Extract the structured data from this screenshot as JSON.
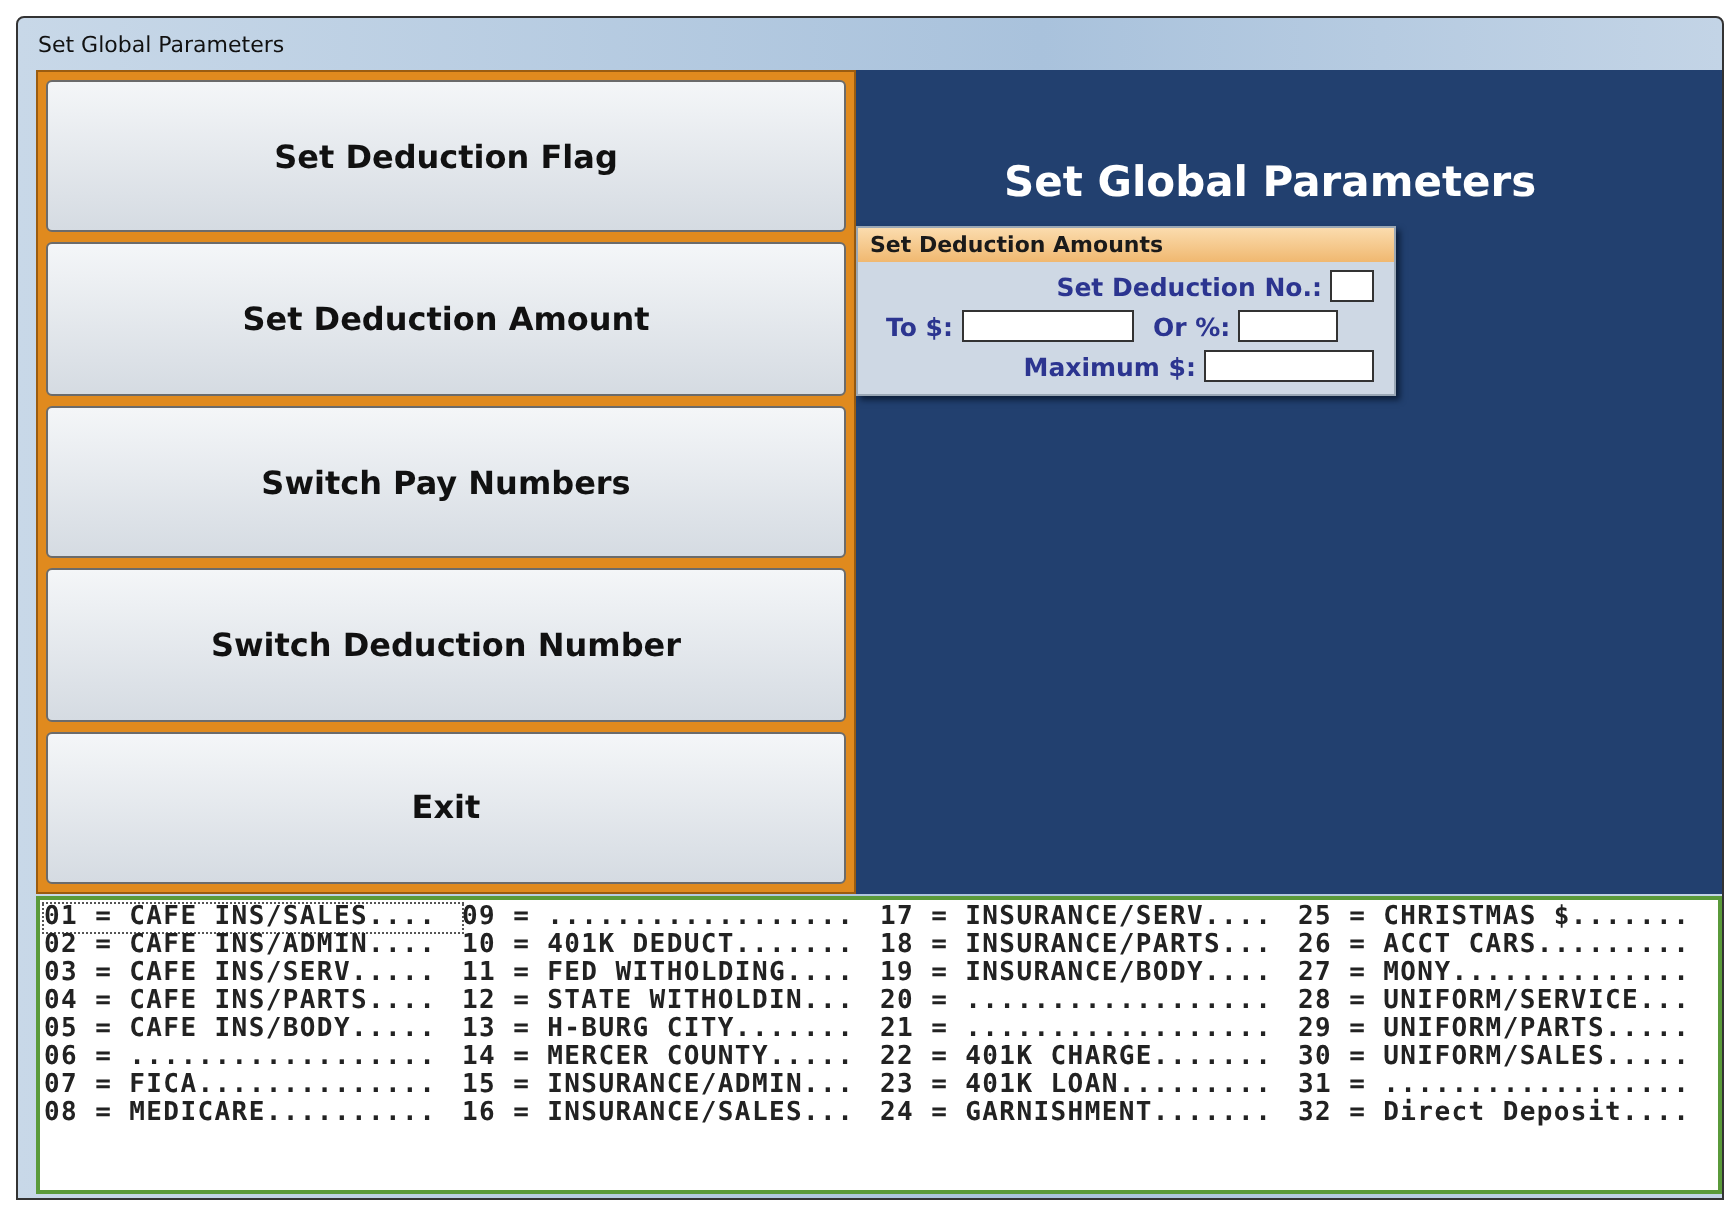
{
  "window": {
    "title": "Set Global Parameters"
  },
  "buttons": [
    {
      "label": "Set Deduction Flag"
    },
    {
      "label": "Set Deduction Amount"
    },
    {
      "label": "Switch Pay Numbers"
    },
    {
      "label": "Switch Deduction Number"
    },
    {
      "label": "Exit"
    }
  ],
  "heading": "Set Global Parameters",
  "deduction_panel": {
    "title": "Set Deduction Amounts",
    "deduction_no_label": "Set Deduction No.:",
    "to_label": "To $:",
    "or_label": "Or %:",
    "maximum_label": "Maximum $:"
  },
  "deduction_list": [
    [
      "01 = CAFE INS/SALES....",
      "09 = ..................",
      "17 = INSURANCE/SERV....",
      "25 = CHRISTMAS $......."
    ],
    [
      "02 = CAFE INS/ADMIN....",
      "10 = 401K DEDUCT.......",
      "18 = INSURANCE/PARTS...",
      "26 = ACCT CARS........."
    ],
    [
      "03 = CAFE INS/SERV.....",
      "11 = FED WITHOLDING....",
      "19 = INSURANCE/BODY....",
      "27 = MONY.............."
    ],
    [
      "04 = CAFE INS/PARTS....",
      "12 = STATE WITHOLDIN...",
      "20 = ..................",
      "28 = UNIFORM/SERVICE..."
    ],
    [
      "05 = CAFE INS/BODY.....",
      "13 = H-BURG CITY.......",
      "21 = ..................",
      "29 = UNIFORM/PARTS....."
    ],
    [
      "06 = ..................",
      "14 = MERCER COUNTY.....",
      "22 = 401K CHARGE.......",
      "30 = UNIFORM/SALES....."
    ],
    [
      "07 = FICA..............",
      "15 = INSURANCE/ADMIN...",
      "23 = 401K LOAN.........",
      "31 = .................."
    ],
    [
      "08 = MEDICARE..........",
      "16 = INSURANCE/SALES...",
      "24 = GARNISHMENT.......",
      "32 = Direct Deposit...."
    ]
  ]
}
